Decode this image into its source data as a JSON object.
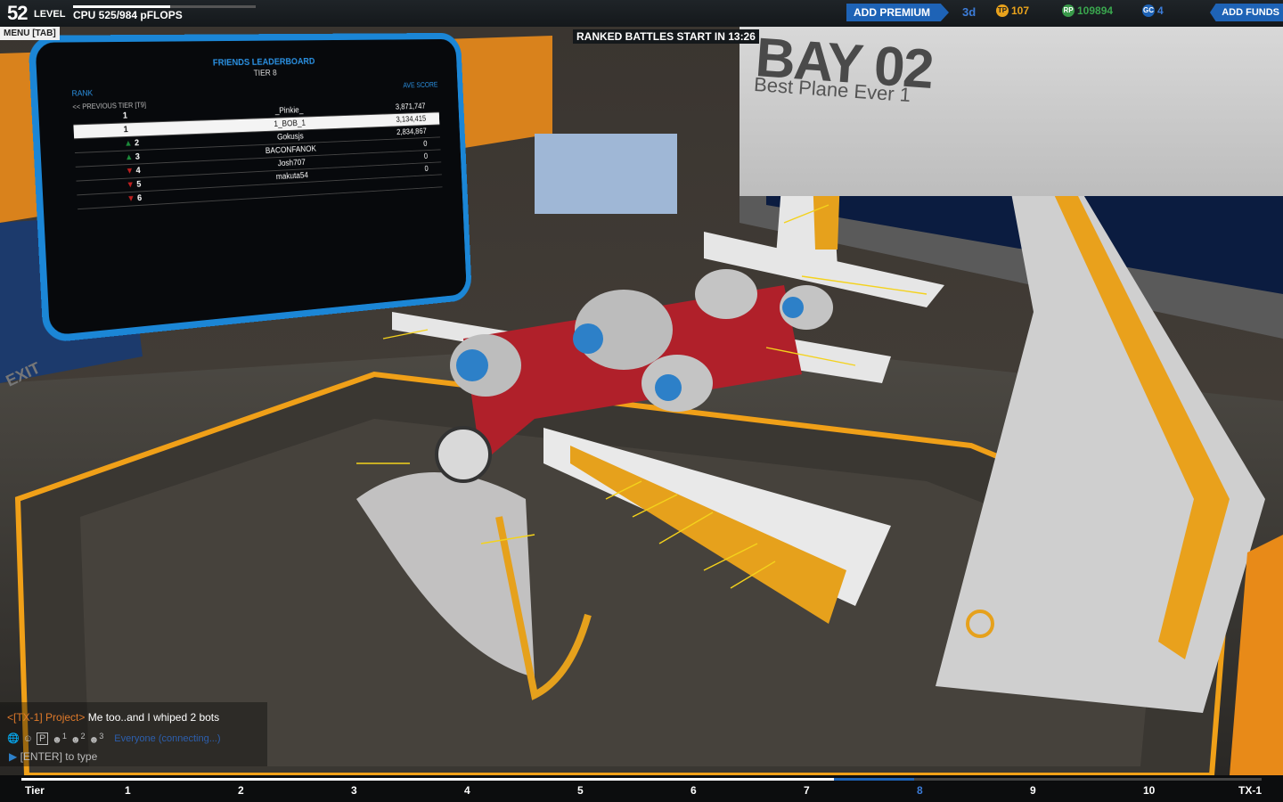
{
  "hud": {
    "level": "52",
    "level_label": "LEVEL",
    "cpu_label": "CPU 525/984 pFLOPS",
    "cpu_fraction": 0.534,
    "menu": "MENU [TAB]",
    "countdown": "RANKED BATTLES START IN 13:26",
    "premium_button": "ADD PREMIUM",
    "premium_days": "3d",
    "stat_tech": "107",
    "stat_rp": "109894",
    "stat_gc": "4",
    "funds_button": "ADD FUNDS",
    "icons": [
      "tech-points-icon",
      "robits-icon",
      "galaxy-coins-icon"
    ]
  },
  "leaderboard": {
    "title": "FRIENDS LEADERBOARD",
    "tier": "TIER 8",
    "rank_header": "RANK",
    "score_header": "AVE SCORE",
    "previous_tier": "<< PREVIOUS TIER [T9]",
    "rows": [
      {
        "rank": "1",
        "name": "_Pinkie_",
        "score": "3,871,747",
        "trend": ""
      },
      {
        "rank": "1",
        "name": "1_BOB_1",
        "score": "3,134,415",
        "trend": ""
      },
      {
        "rank": "2",
        "name": "Gokusjs",
        "score": "2,834,867",
        "trend": "up"
      },
      {
        "rank": "3",
        "name": "BACONFANOK",
        "score": "0",
        "trend": "up"
      },
      {
        "rank": "4",
        "name": "Josh707",
        "score": "0",
        "trend": "down"
      },
      {
        "rank": "5",
        "name": "makuta54",
        "score": "0",
        "trend": "down"
      },
      {
        "rank": "6",
        "name": "",
        "score": "",
        "trend": "down"
      }
    ],
    "exit": "EXIT"
  },
  "bay": {
    "title": "BAY 02",
    "subtitle": "Best Plane Ever 1"
  },
  "chat": {
    "tag": "<[TX-1] Project>",
    "message": " Me too..and I whiped 2 bots",
    "channel": "Everyone (connecting...)",
    "tab_labels": [
      "1",
      "2",
      "3"
    ],
    "input_hint": "[ENTER] to type"
  },
  "tierbar": {
    "start": "Tier",
    "ticks": [
      "1",
      "2",
      "3",
      "4",
      "5",
      "6",
      "7",
      "8",
      "9",
      "10"
    ],
    "end": "TX-1",
    "active": "8",
    "progress_fraction": 0.655,
    "marker_fraction": 0.72
  },
  "colors": {
    "accent_blue": "#1e63b6",
    "leaderboard_blue": "#1b86d6",
    "gold": "#e8a21c",
    "chat_tag": "#e07a2a"
  }
}
